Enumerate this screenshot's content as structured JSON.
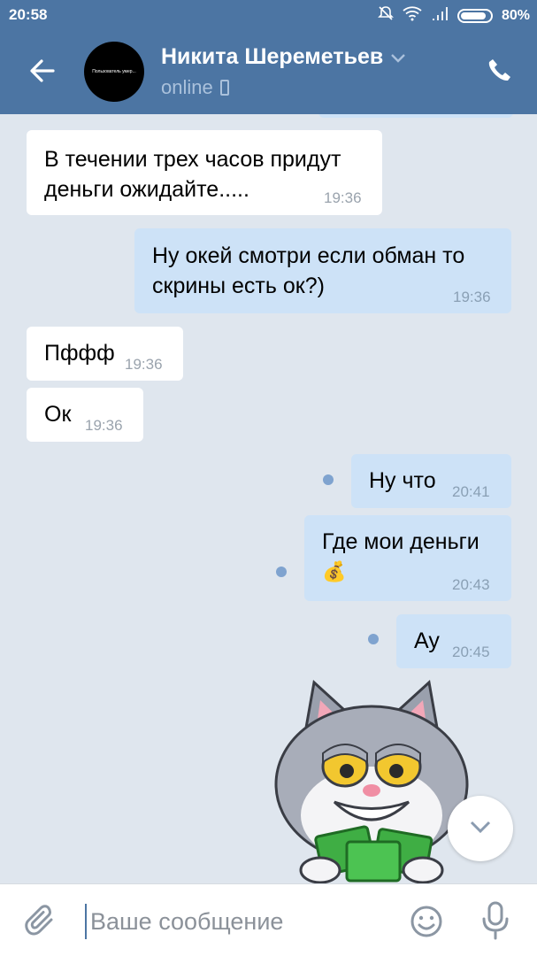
{
  "status_bar": {
    "time": "20:58",
    "battery": "80%"
  },
  "header": {
    "avatar_text": "Пользователь умер...",
    "contact_name": "Никита Шереметьев",
    "status": "online"
  },
  "messages": [
    {
      "dir": "in",
      "lines": [
        "В течении трех часов придут",
        "деньги ожидайте....."
      ],
      "time": "19:36"
    },
    {
      "dir": "out",
      "lines": [
        "Ну окей смотри если обман то",
        "скрины есть ок?)"
      ],
      "time": "19:36"
    },
    {
      "dir": "in",
      "lines": [
        "Пффф"
      ],
      "time": "19:36"
    },
    {
      "dir": "in",
      "lines": [
        "Ок"
      ],
      "time": "19:36"
    },
    {
      "dir": "out",
      "lines": [
        "Ну что"
      ],
      "time": "20:41",
      "unread": true
    },
    {
      "dir": "out",
      "lines": [
        "Где мои деньги",
        "💰"
      ],
      "time": "20:43",
      "unread": true
    },
    {
      "dir": "out",
      "lines": [
        "Ау"
      ],
      "time": "20:45",
      "unread": true
    }
  ],
  "input": {
    "placeholder": "Ваше сообщение"
  },
  "icons": {
    "back": "arrow-left-icon",
    "call": "phone-icon",
    "attach": "paperclip-icon",
    "emoji": "smiley-icon",
    "mic": "microphone-icon",
    "scroll": "chevron-down-icon"
  },
  "colors": {
    "header": "#4c75a3",
    "incoming": "#ffffff",
    "outgoing": "#cde2f7",
    "background": "#dfe6ee"
  }
}
